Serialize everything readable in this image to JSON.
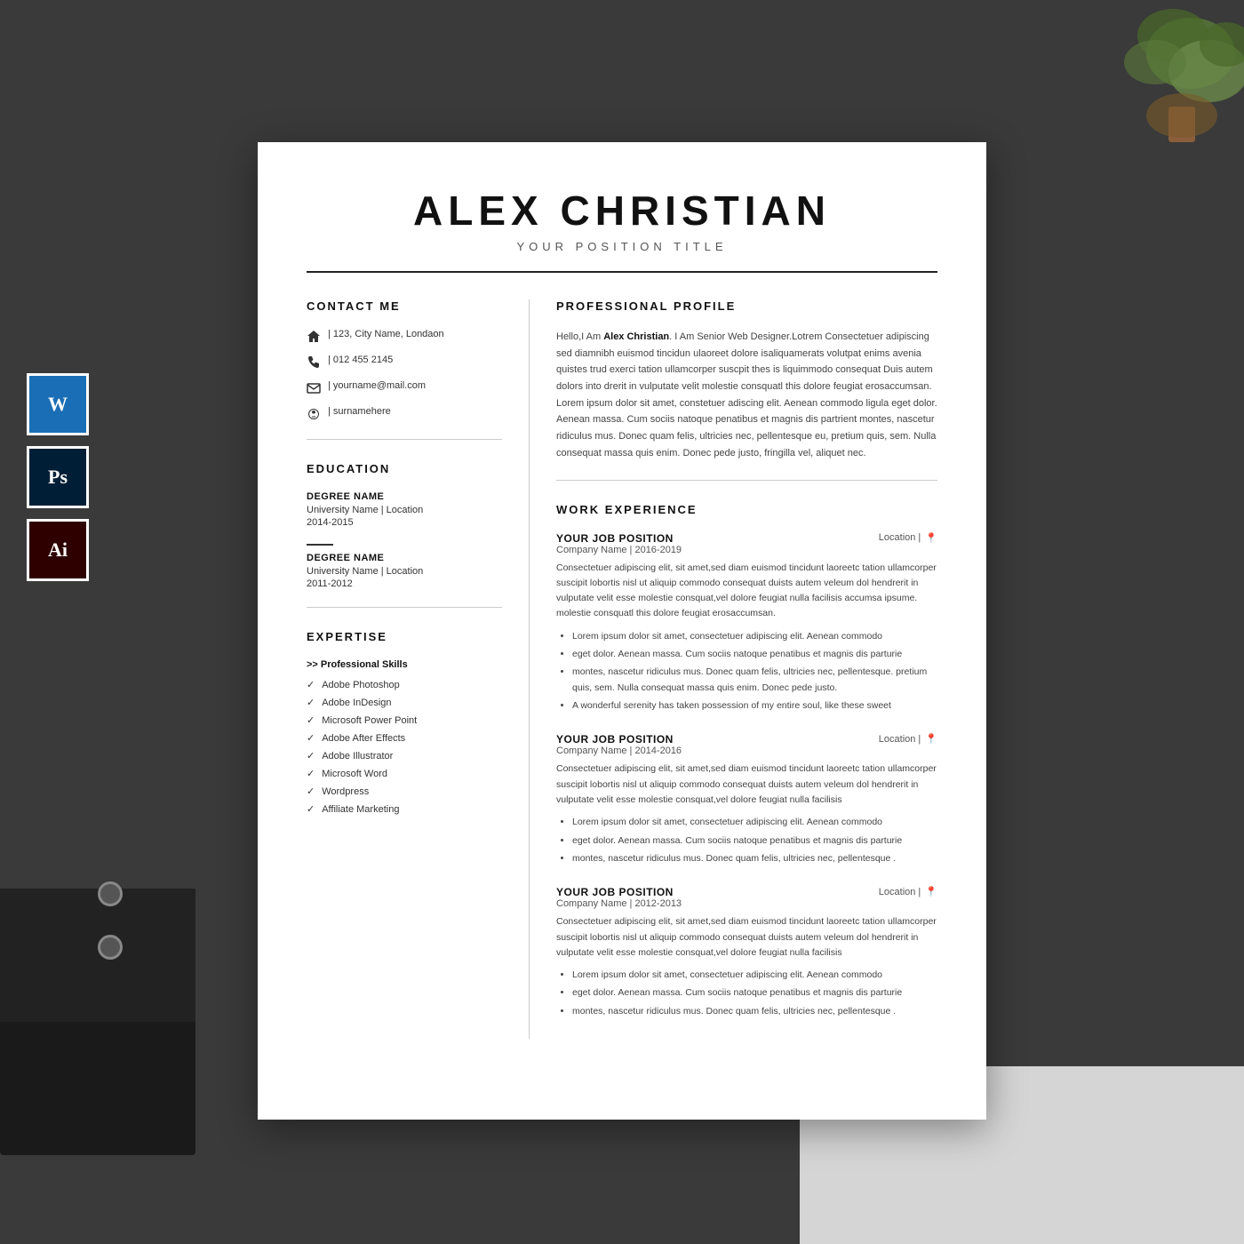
{
  "background": {
    "iconBoxes": [
      {
        "label": "W",
        "id": "word-icon-box"
      },
      {
        "label": "Ps",
        "id": "photoshop-icon-box"
      },
      {
        "label": "Ai",
        "id": "illustrator-icon-box"
      }
    ]
  },
  "header": {
    "name": "ALEX CHRISTIAN",
    "title": "YOUR POSITION TITLE"
  },
  "contact": {
    "sectionTitle": "CONTACT ME",
    "address": "| 123, City Name, Londaon",
    "phone": "| 012 455 2145",
    "email": "| yourname@mail.com",
    "skype": "| surnamehere"
  },
  "education": {
    "sectionTitle": "EDUCATION",
    "items": [
      {
        "degree": "DEGREE NAME",
        "school": "University Name | Location",
        "years": "2014-2015"
      },
      {
        "degree": "DEGREE NAME",
        "school": "University Name | Location",
        "years": "2011-2012"
      }
    ]
  },
  "expertise": {
    "sectionTitle": "EXPERTISE",
    "category": ">> Professional Skills",
    "skills": [
      "Adobe Photoshop",
      "Adobe InDesign",
      "Microsoft Power Point",
      "Adobe After Effects",
      "Adobe Illustrator",
      "Microsoft Word",
      "Wordpress",
      "Affiliate Marketing"
    ]
  },
  "profile": {
    "sectionTitle": "PROFESSIONAL PROFILE",
    "intro": "Hello,I Am ",
    "name": "Alex Christian",
    "nameAfter": ". I Am Senior Web Designer.",
    "body": "Lotrem Consectetuer adipiscing sed diamnibh euismod tincidun ulaoreet dolore isaliquamerats volutpat enims avenia quistes trud exerci tation ullamcorper suscpit thes is liquimmodo consequat Duis autem  dolors into drerit in vulputate velit  molestie consquatl this dolore feugiat erosaccumsan. Lorem ipsum dolor sit amet, constetuer adiscing elit. Aenean commodo ligula eget dolor. Aenean massa. Cum sociis natoque penatibus et magnis dis partrient montes, nascetur ridiculus mus. Donec quam felis, ultricies nec, pellentesque eu, pretium quis, sem. Nulla consequat massa quis enim. Donec pede justo, fringilla vel, aliquet nec."
  },
  "workExperience": {
    "sectionTitle": "WORK EXPERIENCE",
    "jobs": [
      {
        "position": "YOUR JOB POSITION",
        "location": "Location",
        "company": "Company Name | 2016-2019",
        "description": "Consectetuer adipiscing elit, sit amet,sed diam euismod tincidunt laoreetc tation ullamcorper suscipit lobortis nisl ut aliquip commodo consequat duists autem veleum dol hendrerit in vulputate velit esse molestie consquat,vel dolore feugiat nulla facilisis accumsa ipsume. molestie consquatl this dolore feugiat erosaccumsan.",
        "bullets": [
          "Lorem ipsum dolor sit amet, consectetuer adipiscing elit. Aenean commodo",
          "eget dolor. Aenean massa. Cum sociis natoque penatibus et magnis dis parturie",
          "montes, nascetur ridiculus mus. Donec quam felis, ultricies nec, pellentesque. pretium quis, sem. Nulla consequat massa quis enim. Donec pede justo.",
          "A wonderful serenity has taken possession of my entire soul, like these sweet"
        ]
      },
      {
        "position": "YOUR JOB POSITION",
        "location": "Location",
        "company": "Company Name | 2014-2016",
        "description": "Consectetuer adipiscing elit, sit amet,sed diam euismod tincidunt laoreetc tation ullamcorper suscipit lobortis nisl ut aliquip commodo consequat duists autem veleum dol hendrerit in vulputate velit esse molestie consquat,vel dolore feugiat nulla facilisis",
        "bullets": [
          "Lorem ipsum dolor sit amet, consectetuer adipiscing elit. Aenean commodo",
          "eget dolor. Aenean massa. Cum sociis natoque penatibus et magnis dis parturie",
          "montes, nascetur ridiculus mus. Donec quam felis, ultricies nec, pellentesque ."
        ]
      },
      {
        "position": "YOUR JOB POSITION",
        "location": "Location",
        "company": "Company Name | 2012-2013",
        "description": "Consectetuer adipiscing elit, sit amet,sed diam euismod tincidunt laoreetc tation ullamcorper suscipit lobortis nisl ut aliquip commodo consequat duists autem veleum dol hendrerit in vulputate velit esse molestie consquat,vel dolore feugiat nulla facilisis",
        "bullets": [
          "Lorem ipsum dolor sit amet, consectetuer adipiscing elit. Aenean commodo",
          "eget dolor. Aenean massa. Cum sociis natoque penatibus et magnis dis parturie",
          "montes, nascetur ridiculus mus. Donec quam felis, ultricies nec, pellentesque ."
        ]
      }
    ]
  }
}
